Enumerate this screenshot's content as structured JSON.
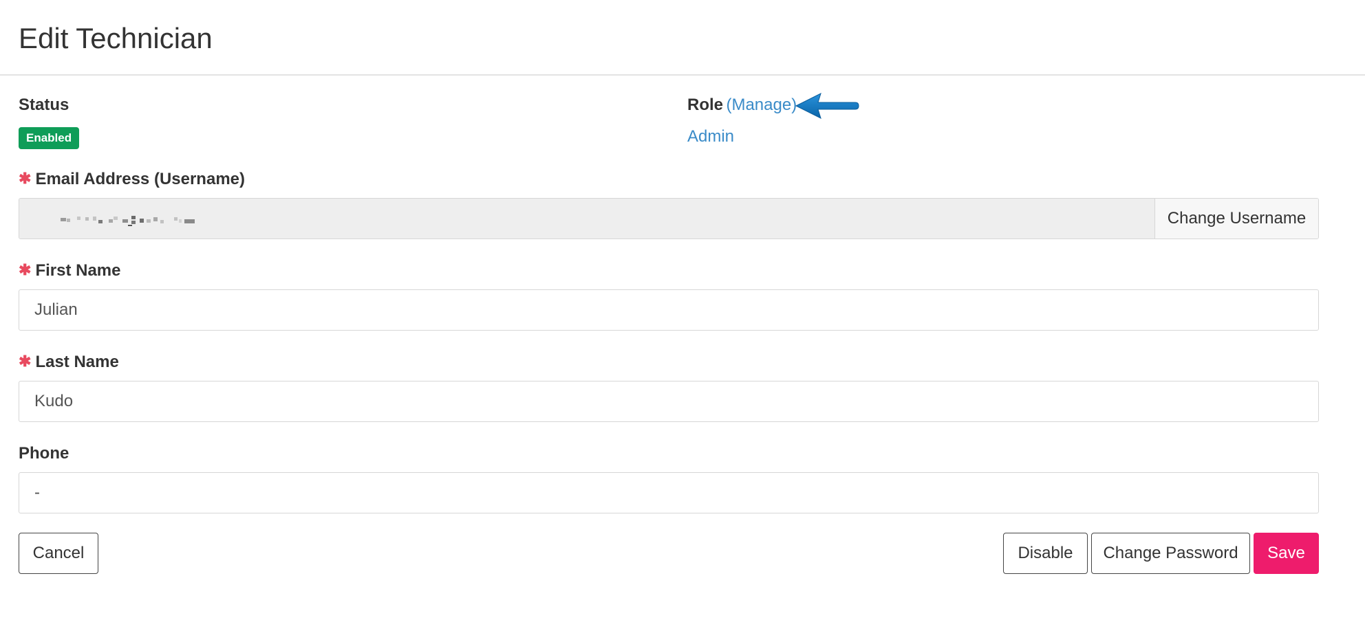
{
  "header": {
    "title": "Edit Technician"
  },
  "status": {
    "label": "Status",
    "badge": "Enabled"
  },
  "role": {
    "label": "Role",
    "manage_link": "(Manage)",
    "value": "Admin"
  },
  "fields": {
    "email": {
      "label": "Email Address (Username)",
      "required": true,
      "change_button": "Change Username"
    },
    "first_name": {
      "label": "First Name",
      "required": true,
      "value": "Julian"
    },
    "last_name": {
      "label": "Last Name",
      "required": true,
      "value": "Kudo"
    },
    "phone": {
      "label": "Phone",
      "required": false,
      "value": "-"
    }
  },
  "required_marker": "✱",
  "actions": {
    "cancel": "Cancel",
    "disable": "Disable",
    "change_password": "Change Password",
    "save": "Save"
  },
  "colors": {
    "status_enabled": "#0f9d58",
    "link": "#3a8bc8",
    "required": "#e84a5f",
    "primary": "#ee1c6c",
    "annotation_arrow": "#1479c4"
  }
}
